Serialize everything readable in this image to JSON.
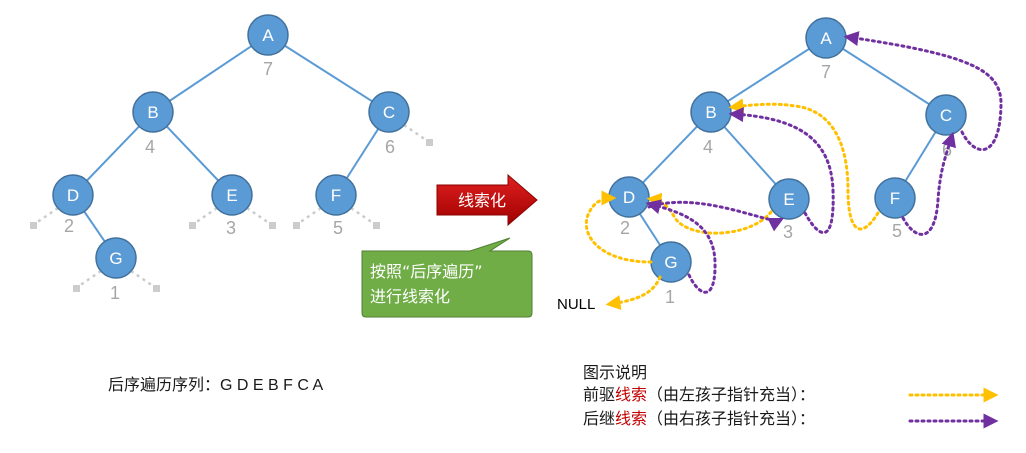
{
  "tree": {
    "nodes": [
      {
        "id": "A",
        "label": "A",
        "order": "7"
      },
      {
        "id": "B",
        "label": "B",
        "order": "4"
      },
      {
        "id": "C",
        "label": "C",
        "order": "6"
      },
      {
        "id": "D",
        "label": "D",
        "order": "2"
      },
      {
        "id": "E",
        "label": "E",
        "order": "3"
      },
      {
        "id": "F",
        "label": "F",
        "order": "5"
      },
      {
        "id": "G",
        "label": "G",
        "order": "1"
      }
    ],
    "edges": [
      [
        "A",
        "B"
      ],
      [
        "A",
        "C"
      ],
      [
        "B",
        "D"
      ],
      [
        "B",
        "E"
      ],
      [
        "C",
        "F"
      ],
      [
        "D",
        "G"
      ]
    ],
    "null_pointers": {
      "C": [
        "right"
      ],
      "D": [
        "left"
      ],
      "E": [
        "left",
        "right"
      ],
      "F": [
        "left",
        "right"
      ],
      "G": [
        "left",
        "right"
      ]
    }
  },
  "threaded": {
    "predecessor_threads": [
      [
        "G",
        "D"
      ],
      [
        "E",
        "D"
      ],
      [
        "F",
        "E"
      ],
      [
        "G",
        "NULL"
      ]
    ],
    "successor_threads": [
      [
        "G",
        "D"
      ],
      [
        "D",
        "E"
      ],
      [
        "E",
        "B"
      ],
      [
        "F",
        "C"
      ],
      [
        "C",
        "A"
      ]
    ],
    "null_label": "NULL"
  },
  "transform_arrow": {
    "label": "线索化"
  },
  "callout": {
    "line1": "按照“后序遍历”",
    "line2": "进行线索化"
  },
  "sequence": {
    "label": "后序遍历序列：",
    "value": "G D E B F C A"
  },
  "legend": {
    "title": "图示说明",
    "pred": {
      "prefix": "前驱",
      "red": "线索",
      "suffix": "（由左孩子指针充当）："
    },
    "succ": {
      "prefix": "后继",
      "red": "线索",
      "suffix": "（由右孩子指针充当）："
    }
  },
  "colors": {
    "node_fill": "#5b9bd5",
    "node_stroke": "#41719c",
    "edge": "#5b9bd5",
    "null_stub": "#cccccc",
    "order_text": "#a6a6a6",
    "pred_thread": "#ffc000",
    "succ_thread": "#7030a0",
    "arrow_fill": "#c00000",
    "callout_fill": "#70ad47",
    "legend_red": "#c00000"
  }
}
